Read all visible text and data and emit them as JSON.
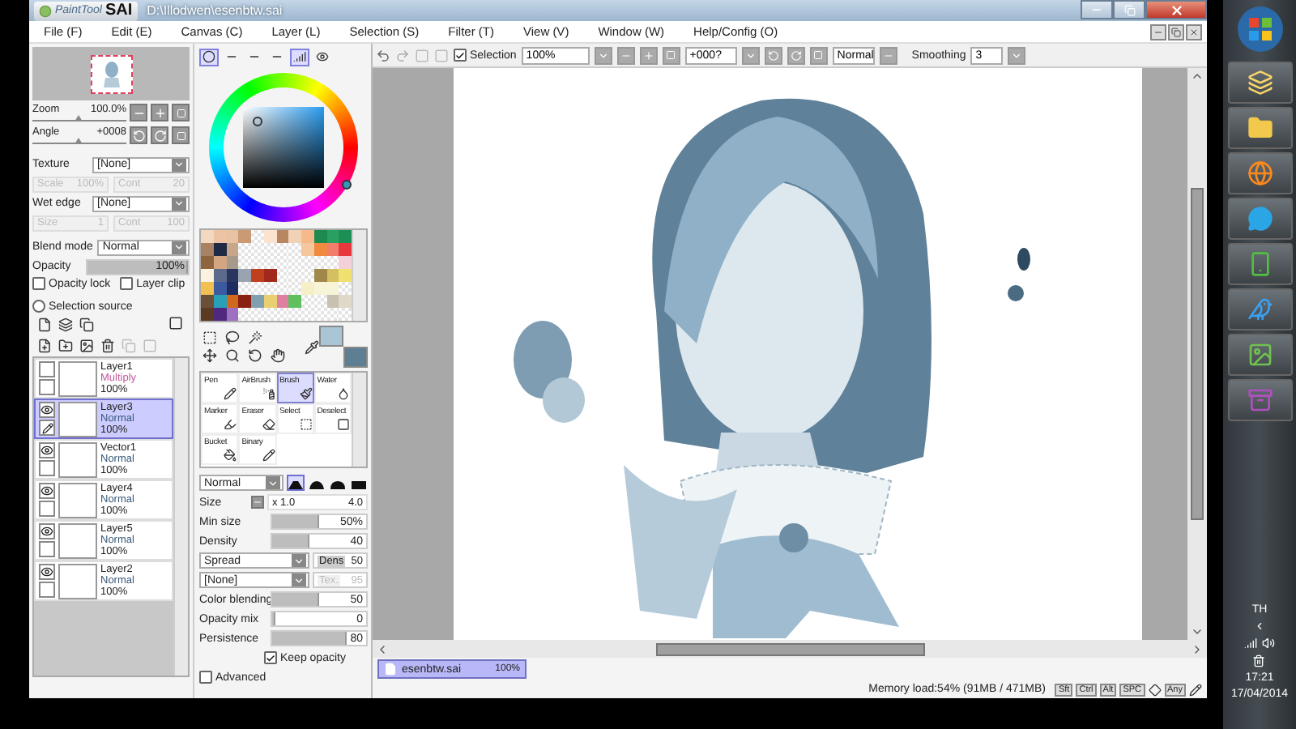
{
  "title_bar": {
    "logo_prefix": "PaintTool",
    "logo_name": "SAI",
    "path": "D:\\Illodwen\\esenbtw.sai"
  },
  "menu": [
    "File (F)",
    "Edit (E)",
    "Canvas (C)",
    "Layer (L)",
    "Selection (S)",
    "Filter (T)",
    "View (V)",
    "Window (W)",
    "Help/Config (O)"
  ],
  "navigator": {
    "zoom": {
      "label": "Zoom",
      "value": "100.0%",
      "level": 0.5
    },
    "angle": {
      "label": "Angle",
      "value": "+0008",
      "level": 0.5
    }
  },
  "texture": {
    "label": "Texture",
    "value": "[None]",
    "fields": [
      {
        "label": "Scale",
        "value": "100%",
        "disabled": true
      },
      {
        "label": "Cont",
        "value": "20",
        "disabled": true
      }
    ]
  },
  "wet_edge": {
    "label": "Wet edge",
    "value": "[None]",
    "fields": [
      {
        "label": "Size",
        "value": "1",
        "disabled": true
      },
      {
        "label": "Cont",
        "value": "100",
        "disabled": true
      }
    ]
  },
  "blend_mode": {
    "label": "Blend mode",
    "value": "Normal"
  },
  "opacity": {
    "label": "Opacity",
    "value": "100%",
    "level": 1
  },
  "options": [
    {
      "kind": "checkbox",
      "label": "Opacity lock",
      "checked": false
    },
    {
      "kind": "checkbox",
      "label": "Layer clip",
      "checked": false
    },
    {
      "kind": "radio",
      "label": "Selection source",
      "checked": false
    }
  ],
  "layers": [
    {
      "name": "Layer1",
      "mode": "Multiply",
      "color": "#c0589a",
      "opacity": "100%",
      "visible": false,
      "editing": false,
      "selected": false
    },
    {
      "name": "Layer3",
      "mode": "Normal",
      "color": "#3a5a7a",
      "opacity": "100%",
      "visible": true,
      "editing": true,
      "selected": true
    },
    {
      "name": "Vector1",
      "mode": "Normal",
      "color": "#3a5a7a",
      "opacity": "100%",
      "visible": true,
      "editing": false,
      "selected": false
    },
    {
      "name": "Layer4",
      "mode": "Normal",
      "color": "#3a5a7a",
      "opacity": "100%",
      "visible": true,
      "editing": false,
      "selected": false
    },
    {
      "name": "Layer5",
      "mode": "Normal",
      "color": "#3a5a7a",
      "opacity": "100%",
      "visible": true,
      "editing": false,
      "selected": false
    },
    {
      "name": "Layer2",
      "mode": "Normal",
      "color": "#3a5a7a",
      "opacity": "100%",
      "visible": true,
      "editing": false,
      "selected": false
    }
  ],
  "color_tabs": [
    {
      "selected": true
    },
    {
      "selected": false
    },
    {
      "selected": false
    },
    {
      "selected": false
    },
    {
      "selected": true
    },
    {
      "selected": false
    }
  ],
  "colors": [
    {
      "color": "#aac5d6"
    },
    {
      "color": "#5d7e93"
    }
  ],
  "palette": [
    [
      {
        "color": "#f3d7bf"
      },
      {
        "color": "#ecc4a4"
      },
      {
        "color": "#e8c3a3"
      },
      {
        "color": "#c99a73"
      },
      {
        "kind": "blank"
      },
      {
        "color": "#fbe3cf"
      },
      {
        "color": "#b98662"
      },
      {
        "color": "#f2d2b6"
      },
      {
        "color": "#f5b98a"
      },
      {
        "color": "#1e8a4f"
      },
      {
        "color": "#27a060"
      },
      {
        "color": "#1c8f57"
      }
    ],
    [
      {
        "color": "#a88263"
      },
      {
        "color": "#1f2a44"
      },
      {
        "color": "#c7a78c"
      },
      {
        "kind": "blank"
      },
      {
        "kind": "blank"
      },
      {
        "kind": "blank"
      },
      {
        "kind": "blank"
      },
      {
        "kind": "blank"
      },
      {
        "color": "#f6c69c"
      },
      {
        "color": "#f08a40"
      },
      {
        "color": "#f07e6a"
      },
      {
        "color": "#e8383d"
      }
    ],
    [
      {
        "color": "#8f6540"
      },
      {
        "color": "#d4a582"
      },
      {
        "color": "#a89a8a"
      },
      {
        "kind": "blank"
      },
      {
        "kind": "blank"
      },
      {
        "kind": "blank"
      },
      {
        "kind": "blank"
      },
      {
        "kind": "blank"
      },
      {
        "kind": "blank"
      },
      {
        "kind": "blank"
      },
      {
        "kind": "blank"
      },
      {
        "color": "#f4d0d8"
      }
    ],
    [
      {
        "color": "#fbf2e0"
      },
      {
        "color": "#5c6a8c"
      },
      {
        "color": "#2a3560"
      },
      {
        "color": "#9aa4b0"
      },
      {
        "color": "#c0401e"
      },
      {
        "color": "#a0281c"
      },
      {
        "kind": "blank"
      },
      {
        "kind": "blank"
      },
      {
        "kind": "blank"
      },
      {
        "color": "#a0884a"
      },
      {
        "color": "#d4c060"
      },
      {
        "color": "#f0e070"
      }
    ],
    [
      {
        "color": "#f0c050"
      },
      {
        "color": "#3c5aa0"
      },
      {
        "color": "#1e2c60"
      },
      {
        "kind": "blank"
      },
      {
        "kind": "blank"
      },
      {
        "kind": "blank"
      },
      {
        "kind": "blank"
      },
      {
        "kind": "blank"
      },
      {
        "color": "#f5f0c8"
      },
      {
        "color": "#f8f4d8"
      },
      {
        "color": "#f8f4d8"
      },
      {
        "kind": "blank"
      }
    ],
    [
      {
        "color": "#6a5038"
      },
      {
        "color": "#2aa0b8"
      },
      {
        "color": "#d0681e"
      },
      {
        "color": "#8a2010"
      },
      {
        "color": "#80a0b0"
      },
      {
        "color": "#e8d070"
      },
      {
        "color": "#e080a0"
      },
      {
        "color": "#60c060"
      },
      {
        "kind": "blank"
      },
      {
        "kind": "blank"
      },
      {
        "color": "#c8c0b0"
      },
      {
        "color": "#e0d8c8"
      }
    ],
    [
      {
        "color": "#5a3a20"
      },
      {
        "color": "#502880"
      },
      {
        "color": "#a070c0"
      },
      {
        "kind": "blank"
      },
      {
        "kind": "blank"
      },
      {
        "kind": "blank"
      },
      {
        "kind": "blank"
      },
      {
        "kind": "blank"
      },
      {
        "kind": "blank"
      },
      {
        "kind": "blank"
      },
      {
        "kind": "blank"
      },
      {
        "kind": "blank"
      }
    ]
  ],
  "tools": [
    {
      "label": "Pen",
      "selected": false
    },
    {
      "label": "AirBrush",
      "selected": false
    },
    {
      "label": "Brush",
      "selected": true
    },
    {
      "label": "Water",
      "selected": false
    },
    {
      "label": "Marker",
      "selected": false
    },
    {
      "label": "Eraser",
      "selected": false
    },
    {
      "label": "Select",
      "selected": false
    },
    {
      "label": "Deselect",
      "selected": false
    },
    {
      "label": "Bucket",
      "selected": false
    },
    {
      "label": "Binary",
      "selected": false
    }
  ],
  "brush": {
    "blend": "Normal",
    "shapes": [
      {
        "selected": true
      },
      {
        "selected": false
      },
      {
        "selected": false
      },
      {
        "selected": false
      }
    ],
    "size": {
      "label": "Size",
      "multiplier": "x 1.0",
      "value": "4.0"
    },
    "rows": [
      {
        "kind": "slider",
        "label": "Min size",
        "value": "50%",
        "level": 0.5
      },
      {
        "kind": "slider",
        "label": "Density",
        "value": "40",
        "level": 0.4
      },
      {
        "kind": "dropdown",
        "value": "Spread",
        "side_label": "Dens",
        "side_value": "50",
        "disabled": false
      },
      {
        "kind": "dropdown",
        "value": "[None]",
        "side_label": "Tex.",
        "side_value": "95",
        "disabled": true
      },
      {
        "kind": "slider",
        "label": "Color blending",
        "value": "50",
        "level": 0.5
      },
      {
        "kind": "slider",
        "label": "Opacity mix",
        "value": "0",
        "level": 0
      },
      {
        "kind": "slider",
        "label": "Persistence",
        "value": "80",
        "level": 0.8
      },
      {
        "kind": "check",
        "label": "Keep opacity",
        "checked": true
      },
      {
        "kind": "check",
        "label": "Advanced",
        "checked": false
      }
    ]
  },
  "canvas_toolbar": {
    "selection": {
      "label": "Selection",
      "checked": true
    },
    "zoom": "100%",
    "angle": "+000?",
    "mode": "Normal",
    "smoothing": {
      "label": "Smoothing",
      "value": "3"
    }
  },
  "file_tabs": [
    {
      "name": "esenbtw.sai",
      "zoom": "100%",
      "selected": true
    }
  ],
  "status": {
    "memory": "Memory load:54% (91MB / 471MB)",
    "keys": [
      "Sft",
      "Ctrl",
      "Alt",
      "SPC"
    ],
    "any": "Any"
  },
  "taskbar": {
    "language": "TH",
    "time": "17:21",
    "date": "17/04/2014"
  }
}
